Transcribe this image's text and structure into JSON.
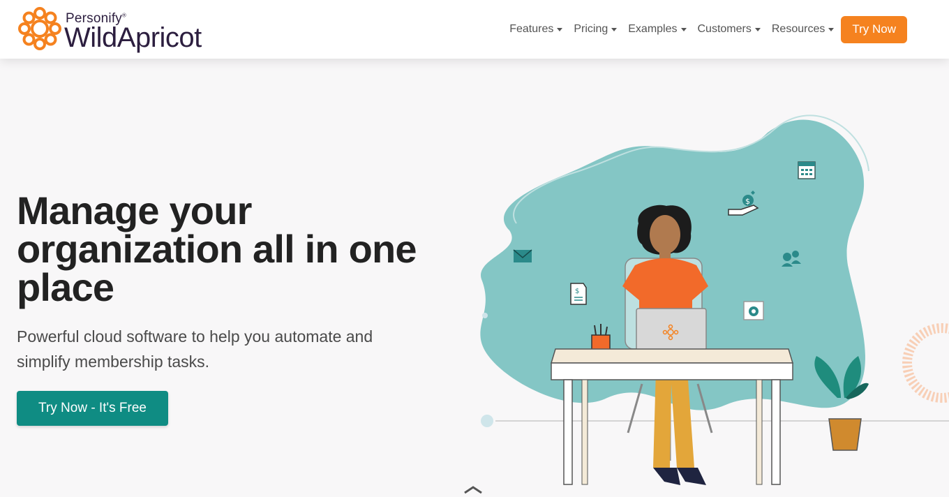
{
  "brand": {
    "sub": "Personify",
    "name": "WildApricot",
    "accent": "#f5821f",
    "dark": "#2c1e3f"
  },
  "nav": {
    "items": [
      {
        "label": "Features"
      },
      {
        "label": "Pricing"
      },
      {
        "label": "Examples"
      },
      {
        "label": "Customers"
      },
      {
        "label": "Resources"
      }
    ],
    "cta": "Try Now"
  },
  "hero": {
    "title": "Manage your organization all in one place",
    "subtitle": "Powerful cloud software to help you automate and simplify membership tasks.",
    "cta": "Try Now - It's Free",
    "cta_color": "#0f8c83"
  },
  "illustration": {
    "icons": [
      "calendar-icon",
      "money-hand-icon",
      "envelope-icon",
      "users-icon",
      "invoice-icon",
      "gear-icon"
    ]
  }
}
